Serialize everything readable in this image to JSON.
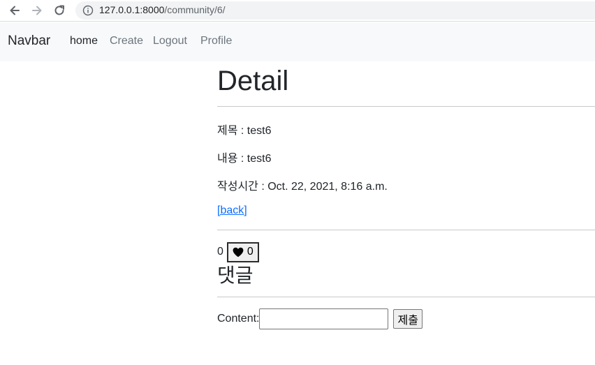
{
  "browser": {
    "url_host": "127.0.0.1:8000",
    "url_path": "/community/6/"
  },
  "navbar": {
    "brand": "Navbar",
    "links": [
      {
        "label": "home"
      },
      {
        "label": "Create"
      },
      {
        "label": "Logout"
      },
      {
        "label": "Profile"
      }
    ]
  },
  "detail": {
    "title": "Detail",
    "title_line": "제목 : test6",
    "content_line": "내용 : test6",
    "created_line": "작성시간 : Oct. 22, 2021, 8:16 a.m.",
    "back_link": "[back]"
  },
  "likes": {
    "count": "0",
    "button_count": "0"
  },
  "comments": {
    "heading": "댓글",
    "form_label": "Content:",
    "input_value": "",
    "submit_label": "제출"
  },
  "icons": {
    "back": "arrow-left-icon",
    "forward": "arrow-right-icon",
    "reload": "reload-icon",
    "info": "info-icon",
    "heart": "heart-icon"
  },
  "colors": {
    "link": "#0d6efd",
    "navbar_bg": "#f8f9fa",
    "nav_muted": "#6c757d"
  }
}
